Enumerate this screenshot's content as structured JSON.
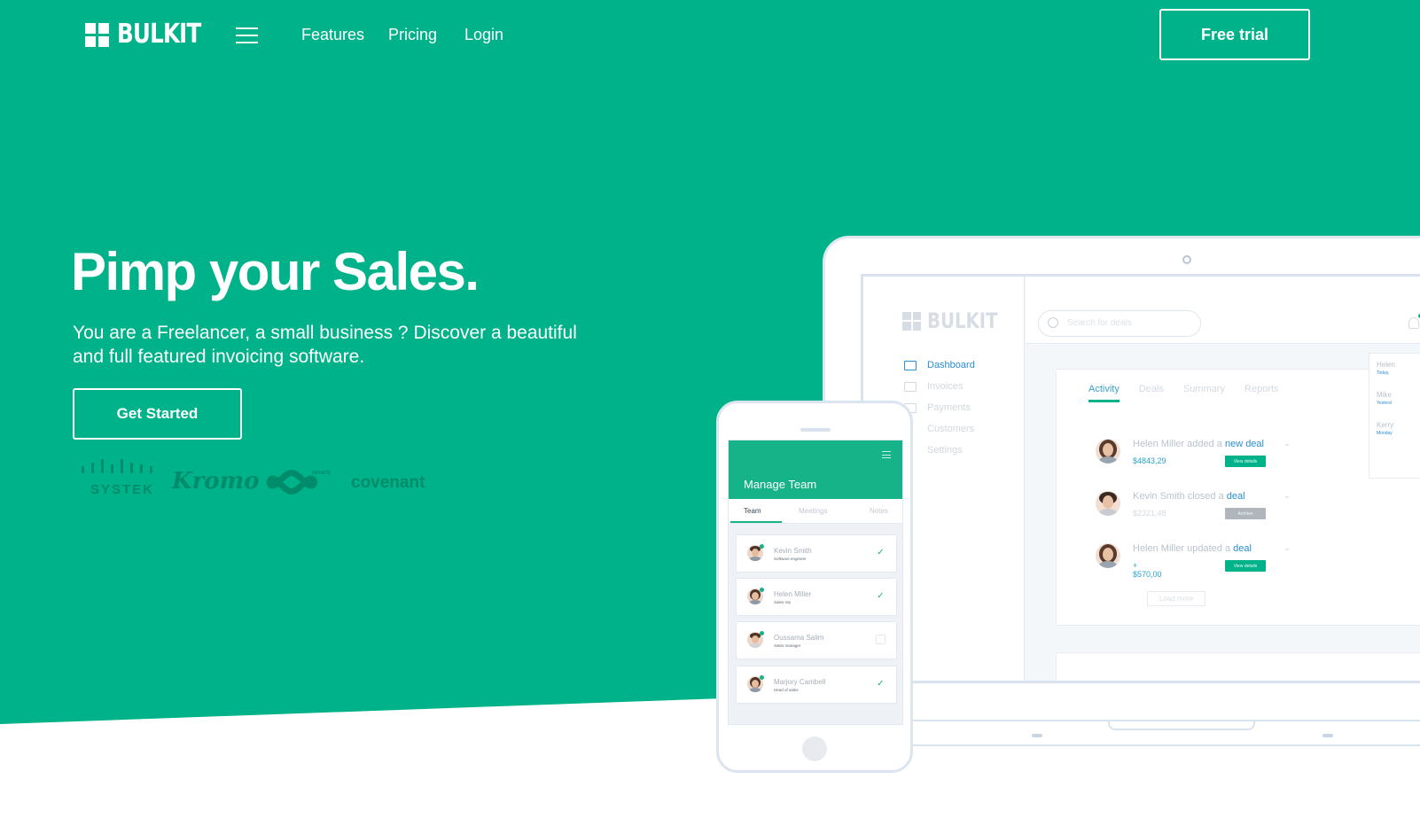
{
  "brand": {
    "name": "BULKIT"
  },
  "colors": {
    "primary": "#00b289",
    "white": "#ffffff"
  },
  "nav": {
    "menu_icon": "hamburger-icon",
    "links": [
      "Features",
      "Pricing",
      "Login"
    ],
    "cta": "Free trial"
  },
  "hero": {
    "title": "Pimp your Sales.",
    "subtitle": "You are a Freelancer, a small business ? Discover a beautiful and full featured invoicing software.",
    "cta": "Get Started"
  },
  "clients": [
    "SYSTEK",
    "Kromo",
    "INFINITE",
    "covenant"
  ],
  "laptop_app": {
    "brand": "BULKIT",
    "search_placeholder": "Search for deals",
    "menu": [
      "Dashboard",
      "Invoices",
      "Payments",
      "Customers",
      "Settings"
    ],
    "tabs": [
      "Activity",
      "Deals",
      "Summary",
      "Reports"
    ],
    "activities": [
      {
        "prefix": "Helen Miller added a ",
        "link": "new deal",
        "amount": "$4843,29",
        "button": "View details"
      },
      {
        "prefix": "Kevin Smith closed a ",
        "link": "deal",
        "amount": "$2321,48",
        "button": "Archive"
      },
      {
        "prefix": "Helen Miller updated a ",
        "link": "deal",
        "amount": "+ $570,00",
        "button": "View details"
      }
    ],
    "load_more": "Load more",
    "side_panel": [
      {
        "name": "Helen",
        "time": "Today,"
      },
      {
        "name": "Mike",
        "time": "Yesterd"
      },
      {
        "name": "Kerry",
        "time": "Monday"
      }
    ]
  },
  "phone_app": {
    "title": "Manage Team",
    "tabs": [
      "Team",
      "Meetings",
      "Notes"
    ],
    "members": [
      {
        "name": "Kevin Smith",
        "role": "Software engineer",
        "checked": true
      },
      {
        "name": "Helen Miller",
        "role": "Sales rep",
        "checked": true
      },
      {
        "name": "Oussama Salim",
        "role": "Sales manager",
        "checked": false
      },
      {
        "name": "Marjory Cambell",
        "role": "Head of sales",
        "checked": true
      }
    ]
  }
}
